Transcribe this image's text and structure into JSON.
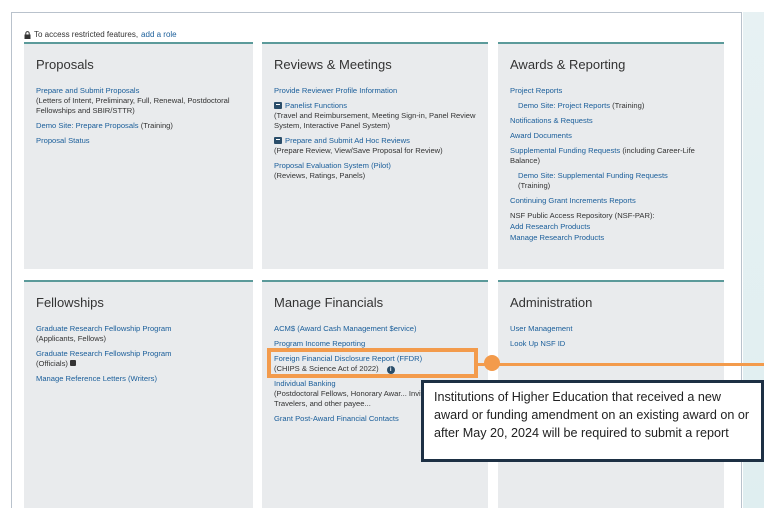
{
  "notice": {
    "prefix": "To access restricted features,",
    "link": "add a role"
  },
  "panels": {
    "proposals": {
      "title": "Proposals",
      "items": [
        {
          "link": "Prepare and Submit Proposals",
          "sub": "(Letters of Intent, Preliminary, Full, Renewal, Postdoctoral Fellowships and SBIR/STTR)"
        },
        {
          "link": "Demo Site: Prepare Proposals",
          "suffix": "(Training)"
        },
        {
          "link": "Proposal Status"
        }
      ]
    },
    "reviews": {
      "title": "Reviews & Meetings",
      "items": [
        {
          "link": "Provide Reviewer Profile Information"
        },
        {
          "link": "Panelist Functions",
          "sub": "(Travel and Reimbursement, Meeting Sign-in, Panel Review System, Interactive Panel System)"
        },
        {
          "link": "Prepare and Submit Ad Hoc Reviews",
          "sub": "(Prepare Review, View/Save Proposal for Review)"
        },
        {
          "link": "Proposal Evaluation System (Pilot)",
          "sub": "(Reviews, Ratings, Panels)"
        }
      ]
    },
    "awards": {
      "title": "Awards & Reporting",
      "items": [
        {
          "link": "Project Reports"
        },
        {
          "link": "Demo Site: Project Reports",
          "suffix": "(Training)"
        },
        {
          "link": "Notifications & Requests"
        },
        {
          "link": "Award Documents"
        },
        {
          "link": "Supplemental Funding Requests",
          "suffix": "(including Career-Life Balance)"
        },
        {
          "link": "Demo Site: Supplemental Funding Requests",
          "suffix": "(Training)"
        },
        {
          "link": "Continuing Grant Increments Reports"
        },
        {
          "text": "NSF Public Access Repository (NSF-PAR):"
        },
        {
          "link": "Add Research Products"
        },
        {
          "link": "Manage Research Products"
        }
      ]
    },
    "fellowships": {
      "title": "Fellowships",
      "items": [
        {
          "link": "Graduate Research Fellowship Program",
          "sub": "(Applicants, Fellows)"
        },
        {
          "link": "Graduate Research Fellowship Program",
          "sub": "(Officials)"
        },
        {
          "link": "Manage Reference Letters (Writers)"
        }
      ]
    },
    "financials": {
      "title": "Manage Financials",
      "items": [
        {
          "link": "ACM$ (Award Cash Management $ervice)"
        },
        {
          "link": "Program Income Reporting"
        },
        {
          "link": "Foreign Financial Disclosure Report (FFDR)",
          "sub": "(CHIPS & Science Act of 2022)"
        },
        {
          "link": "Individual Banking",
          "sub": "(Postdoctoral Fellows, Honorary Awar... Invitational Travelers, and other payee..."
        },
        {
          "link": "Grant Post-Award Financial Contacts"
        }
      ]
    },
    "administration": {
      "title": "Administration",
      "items": [
        {
          "link": "User Management"
        },
        {
          "link": "Look Up NSF ID"
        }
      ]
    }
  },
  "callout": "Institutions of Higher Education that received a new award or funding amendment on an existing award on or after May 20, 2024 will be required to submit a report",
  "colors": {
    "link": "#1a5e9a",
    "panel_bg": "#e9ebed",
    "panel_top": "#5b9a9a",
    "highlight": "#f39b4c",
    "callout_border": "#1d3044"
  }
}
